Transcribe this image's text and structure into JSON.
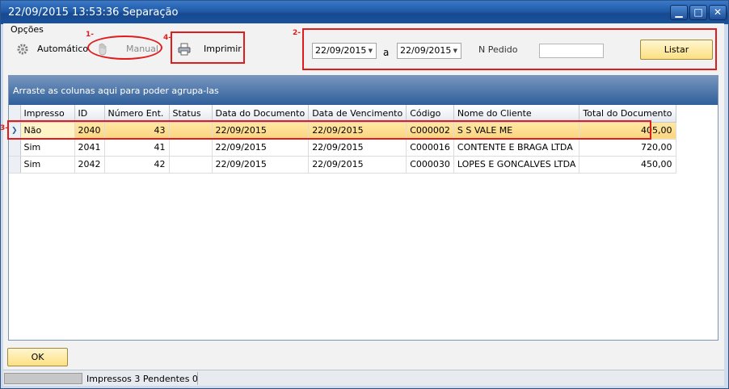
{
  "window": {
    "title": "22/09/2015 13:53:36 Separação"
  },
  "options": {
    "label": "Opções",
    "automatic_label": "Automático",
    "manual_label": "Manual",
    "print_label": "Imprimir"
  },
  "annotations": {
    "n1": "1-",
    "n2": "2-",
    "n3": "3-",
    "n4": "4-"
  },
  "filters": {
    "date_from": "22/09/2015",
    "separator": "a",
    "date_to": "22/09/2015",
    "order_label": "N Pedido",
    "order_value": "",
    "list_label": "Listar"
  },
  "grid": {
    "group_hint": "Arraste as colunas aqui para poder agrupa-las",
    "columns": [
      "Impresso",
      "ID",
      "Número Ent.",
      "Status",
      "Data do Documento",
      "Data de Vencimento",
      "Código",
      "Nome do Cliente",
      "Total do Documento"
    ],
    "rows": [
      {
        "impresso": "Não",
        "id": "2040",
        "numero": "43",
        "status": "",
        "data_doc": "22/09/2015",
        "data_venc": "22/09/2015",
        "codigo": "C000002",
        "cliente": "S S VALE ME",
        "total": "405,00"
      },
      {
        "impresso": "Sim",
        "id": "2041",
        "numero": "41",
        "status": "",
        "data_doc": "22/09/2015",
        "data_venc": "22/09/2015",
        "codigo": "C000016",
        "cliente": "CONTENTE E BRAGA LTDA",
        "total": "720,00"
      },
      {
        "impresso": "Sim",
        "id": "2042",
        "numero": "42",
        "status": "",
        "data_doc": "22/09/2015",
        "data_venc": "22/09/2015",
        "codigo": "C000030",
        "cliente": "LOPES E GONCALVES LTDA",
        "total": "450,00"
      }
    ]
  },
  "footer": {
    "ok_label": "OK"
  },
  "status": {
    "text": "Impressos 3  Pendentes 0"
  },
  "colors": {
    "annotation": "#e01c1c",
    "selected_row": "#fcd580",
    "title_bar": "#1f5aa8"
  }
}
